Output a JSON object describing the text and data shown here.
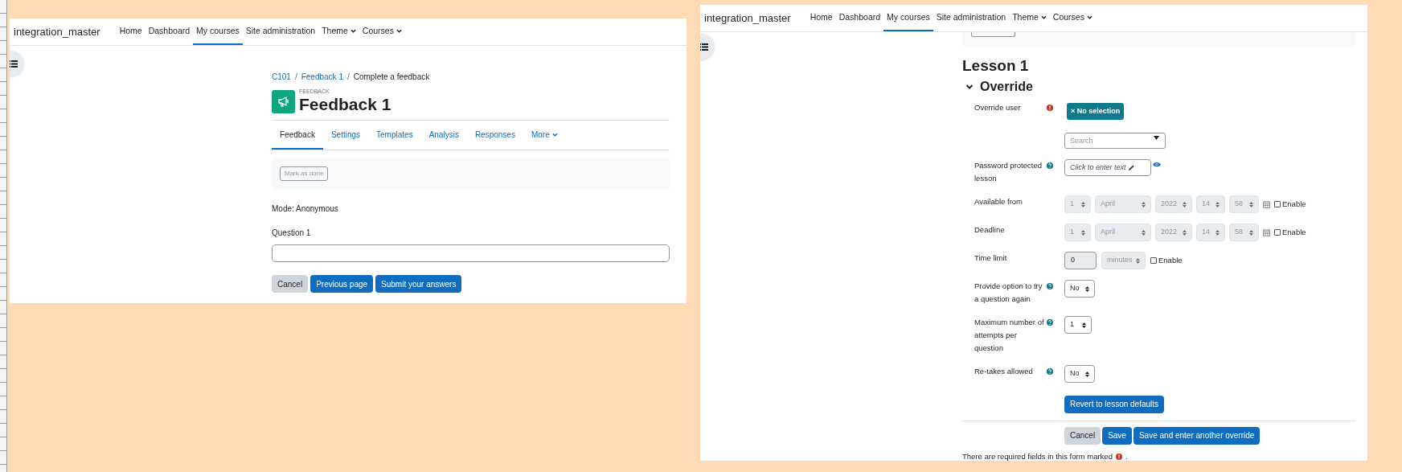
{
  "left_window": {
    "nav": {
      "brand": "integration_master",
      "items": [
        {
          "label": "Home",
          "selected": false,
          "dropdown": false
        },
        {
          "label": "Dashboard",
          "selected": false,
          "dropdown": false
        },
        {
          "label": "My courses",
          "selected": true,
          "dropdown": false
        },
        {
          "label": "Site administration",
          "selected": false,
          "dropdown": false
        },
        {
          "label": "Theme",
          "selected": false,
          "dropdown": true
        },
        {
          "label": "Courses",
          "selected": false,
          "dropdown": true
        }
      ]
    },
    "breadcrumb_separator": "/",
    "breadcrumb": [
      {
        "label": "C101",
        "link": true
      },
      {
        "label": "Feedback 1",
        "link": true
      },
      {
        "label": "Complete a feedback",
        "link": false
      }
    ],
    "activity_type": "FEEDBACK",
    "title": "Feedback 1",
    "tabs": [
      {
        "label": "Feedback",
        "selected": true,
        "dropdown": false
      },
      {
        "label": "Settings",
        "selected": false,
        "dropdown": false
      },
      {
        "label": "Templates",
        "selected": false,
        "dropdown": false
      },
      {
        "label": "Analysis",
        "selected": false,
        "dropdown": false
      },
      {
        "label": "Responses",
        "selected": false,
        "dropdown": false
      },
      {
        "label": "More",
        "selected": false,
        "dropdown": true
      }
    ],
    "mark_done": "Mark as done",
    "mode": "Mode: Anonymous",
    "question": "Question 1",
    "buttons": [
      {
        "label": "Cancel",
        "kind": "secondary"
      },
      {
        "label": "Previous page",
        "kind": "primary"
      },
      {
        "label": "Submit your answers",
        "kind": "primary"
      }
    ]
  },
  "right_window": {
    "nav": {
      "brand": "integration_master",
      "items": [
        {
          "label": "Home",
          "selected": false,
          "dropdown": false
        },
        {
          "label": "Dashboard",
          "selected": false,
          "dropdown": false
        },
        {
          "label": "My courses",
          "selected": true,
          "dropdown": false
        },
        {
          "label": "Site administration",
          "selected": false,
          "dropdown": false
        },
        {
          "label": "Theme",
          "selected": false,
          "dropdown": true
        },
        {
          "label": "Courses",
          "selected": false,
          "dropdown": true
        }
      ]
    },
    "title": "Lesson 1",
    "section": {
      "title": "Override",
      "expanded": true
    },
    "rows": [
      {
        "kind": "autocomplete",
        "label": "Override user",
        "required": true,
        "help": false,
        "selection": "× No selection",
        "placeholder": "Search"
      },
      {
        "kind": "password",
        "label": "Password protected lesson",
        "required": false,
        "help": true,
        "value": "Click to enter text"
      },
      {
        "kind": "date",
        "label": "Available from",
        "required": false,
        "help": false,
        "disabled": true,
        "fields": [
          "1",
          "April",
          "2022",
          "14",
          "58"
        ],
        "enable": {
          "label": "Enable",
          "checked": false
        }
      },
      {
        "kind": "date",
        "label": "Deadline",
        "required": false,
        "help": false,
        "disabled": true,
        "fields": [
          "1",
          "April",
          "2022",
          "14",
          "58"
        ],
        "enable": {
          "label": "Enable",
          "checked": false
        }
      },
      {
        "kind": "duration",
        "label": "Time limit",
        "required": false,
        "help": false,
        "disabled": true,
        "value": "0",
        "unit": "minutes",
        "enable": {
          "label": "Enable",
          "checked": false
        }
      },
      {
        "kind": "select",
        "label": "Provide option to try a question again",
        "required": false,
        "help": true,
        "value": "No"
      },
      {
        "kind": "select",
        "label": "Maximum number of attempts per question",
        "required": false,
        "help": true,
        "value": "1"
      },
      {
        "kind": "select",
        "label": "Re-takes allowed",
        "required": false,
        "help": true,
        "value": "No"
      }
    ],
    "revert_button": "Revert to lesson defaults",
    "buttons": [
      {
        "label": "Cancel",
        "kind": "secondary"
      },
      {
        "label": "Save",
        "kind": "primary"
      },
      {
        "label": "Save and enter another override",
        "kind": "primary"
      }
    ],
    "required_note": {
      "text": "There are required fields in this form marked",
      "suffix": "."
    }
  }
}
